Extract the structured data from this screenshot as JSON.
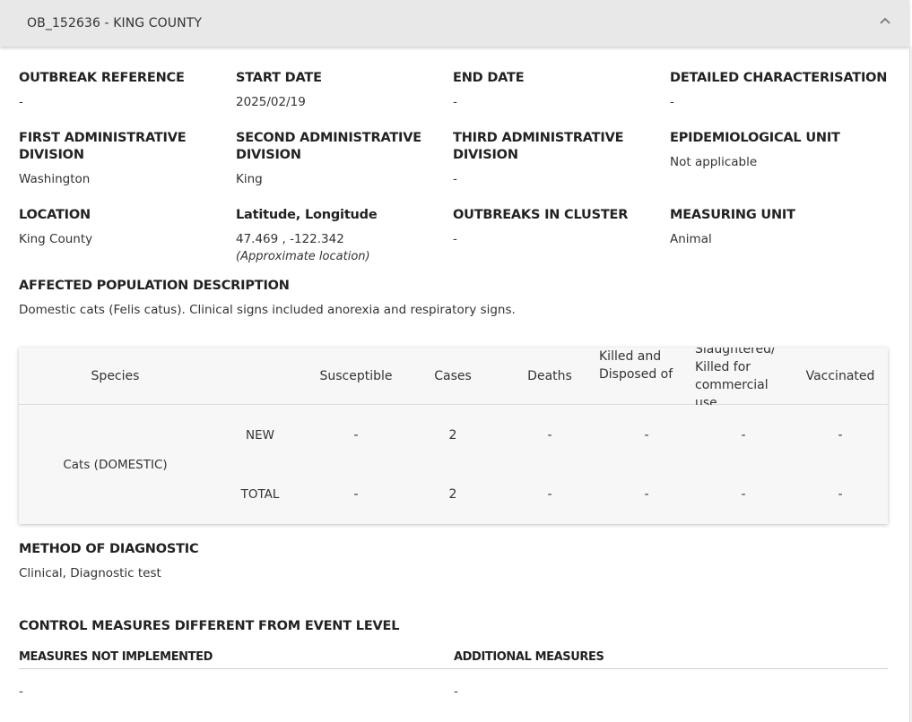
{
  "header": {
    "title": "OB_152636 - KING COUNTY"
  },
  "fields": {
    "outbreak_reference": {
      "label": "OUTBREAK REFERENCE",
      "value": "-"
    },
    "start_date": {
      "label": "START DATE",
      "value": "2025/02/19"
    },
    "end_date": {
      "label": "END DATE",
      "value": "-"
    },
    "detailed_characterisation": {
      "label": "DETAILED CHARACTERISATION",
      "value": "-"
    },
    "first_admin_division": {
      "label_1": "FIRST ADMINISTRATIVE",
      "label_2": "DIVISION",
      "value": "Washington"
    },
    "second_admin_division": {
      "label_1": "SECOND ADMINISTRATIVE",
      "label_2": "DIVISION",
      "value": "King"
    },
    "third_admin_division": {
      "label_1": "THIRD ADMINISTRATIVE",
      "label_2": "DIVISION",
      "value": "-"
    },
    "epidemiological_unit": {
      "label": "EPIDEMIOLOGICAL UNIT",
      "value": "Not applicable"
    },
    "location": {
      "label": "LOCATION",
      "value": "King County"
    },
    "lat_long": {
      "label": "Latitude, Longitude",
      "value": "47.469 , -122.342",
      "note": "(Approximate location)"
    },
    "outbreaks_in_cluster": {
      "label": "OUTBREAKS IN CLUSTER",
      "value": "-"
    },
    "measuring_unit": {
      "label": "MEASURING UNIT",
      "value": "Animal"
    }
  },
  "affected_population": {
    "label": "AFFECTED POPULATION DESCRIPTION",
    "value": "Domestic cats (Felis catus). Clinical signs included anorexia and respiratory signs."
  },
  "table": {
    "headers": {
      "species": "Species",
      "susceptible": "Susceptible",
      "cases": "Cases",
      "deaths": "Deaths",
      "killed_1": "Killed and",
      "killed_2": "Disposed of",
      "slaughtered_1": "Slaughtered/",
      "slaughtered_2": "Killed for",
      "slaughtered_3": "commercial",
      "slaughtered_4": "use",
      "vaccinated": "Vaccinated"
    },
    "species": "Cats (DOMESTIC)",
    "rows": [
      {
        "label": "NEW",
        "susceptible": "-",
        "cases": "2",
        "deaths": "-",
        "killed": "-",
        "slaughtered": "-",
        "vaccinated": "-"
      },
      {
        "label": "TOTAL",
        "susceptible": "-",
        "cases": "2",
        "deaths": "-",
        "killed": "-",
        "slaughtered": "-",
        "vaccinated": "-"
      }
    ]
  },
  "method_of_diagnostic": {
    "label": "METHOD OF DIAGNOSTIC",
    "value": "Clinical, Diagnostic test"
  },
  "control_measures": {
    "label": "CONTROL MEASURES DIFFERENT FROM EVENT LEVEL",
    "not_implemented_label": "MEASURES NOT IMPLEMENTED",
    "not_implemented_value": "-",
    "additional_label": "ADDITIONAL MEASURES",
    "additional_value": "-"
  },
  "icons": {
    "collapse": "chevron-up-icon"
  }
}
